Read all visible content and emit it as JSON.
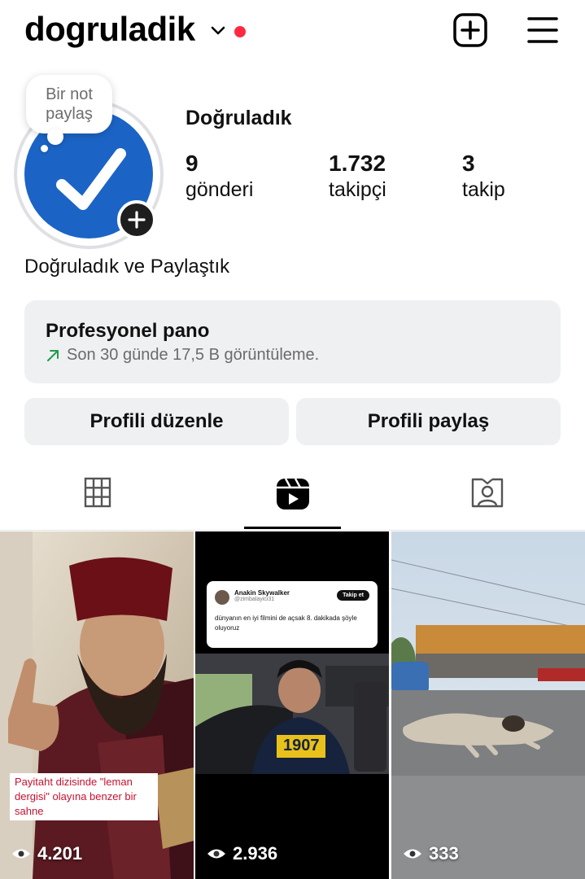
{
  "header": {
    "username": "dogruladik",
    "icons": {
      "dropdown": "chevron-down-icon",
      "notification_dot": "red-dot",
      "create": "plus-square-icon",
      "menu": "hamburger-menu-icon"
    }
  },
  "note": {
    "text": "Bir not paylaş"
  },
  "profile": {
    "display_name": "Doğruladık",
    "stats": [
      {
        "value": "9",
        "label": "gönderi"
      },
      {
        "value": "1.732",
        "label": "takipçi"
      },
      {
        "value": "3",
        "label": "takip"
      }
    ],
    "bio": "Doğruladık ve Paylaştık"
  },
  "dashboard": {
    "title": "Profesyonel pano",
    "subtitle": "Son 30 günde 17,5 B görüntüleme."
  },
  "buttons": {
    "edit": "Profili düzenle",
    "share": "Profili paylaş"
  },
  "tabs": [
    {
      "name": "posts",
      "icon": "grid-icon",
      "active": false
    },
    {
      "name": "reels",
      "icon": "reels-icon",
      "active": true
    },
    {
      "name": "tagged",
      "icon": "tagged-person-icon",
      "active": false
    }
  ],
  "posts": [
    {
      "views": "4.201",
      "caption": "Payitaht dizisinde \"leman dergisi\" olayına benzer bir sahne"
    },
    {
      "views": "2.936",
      "tweet": {
        "name": "Anakin Skywalker",
        "handle": "@zimbalayici31",
        "follow": "Takip et",
        "text": "dünyanın en iyi filmini de açsak 8. dakikada şöyle oluyoruz"
      },
      "jersey": "1907"
    },
    {
      "views": "333"
    }
  ],
  "colors": {
    "accent_blue": "#1b64c6",
    "notification_red": "#ff2a42",
    "trend_green": "#1f9d4c",
    "surface": "#eff0f2"
  }
}
